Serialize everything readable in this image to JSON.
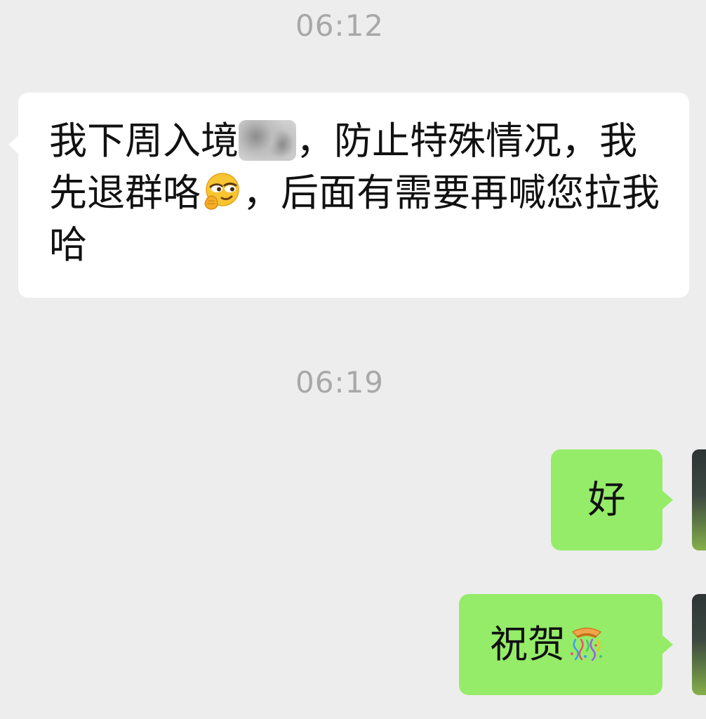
{
  "chat": {
    "timestamps": [
      "06:12",
      "06:19"
    ],
    "messages": [
      {
        "direction": "incoming",
        "text_part1": "我下周入境",
        "blurred": "redacted-image",
        "text_part2": "，防止特殊情况，我先退群咯",
        "emoji": "smirk-hand-on-chin-emoji",
        "text_part3": "，后面有需要再喊您拉我哈"
      },
      {
        "direction": "outgoing",
        "text": "好"
      },
      {
        "direction": "outgoing",
        "text": "祝贺",
        "emoji": "confetti-ball-emoji"
      }
    ]
  },
  "colors": {
    "background": "#ededed",
    "incoming_bubble": "#ffffff",
    "outgoing_bubble": "#95ec69",
    "timestamp": "#a8a8a8"
  }
}
